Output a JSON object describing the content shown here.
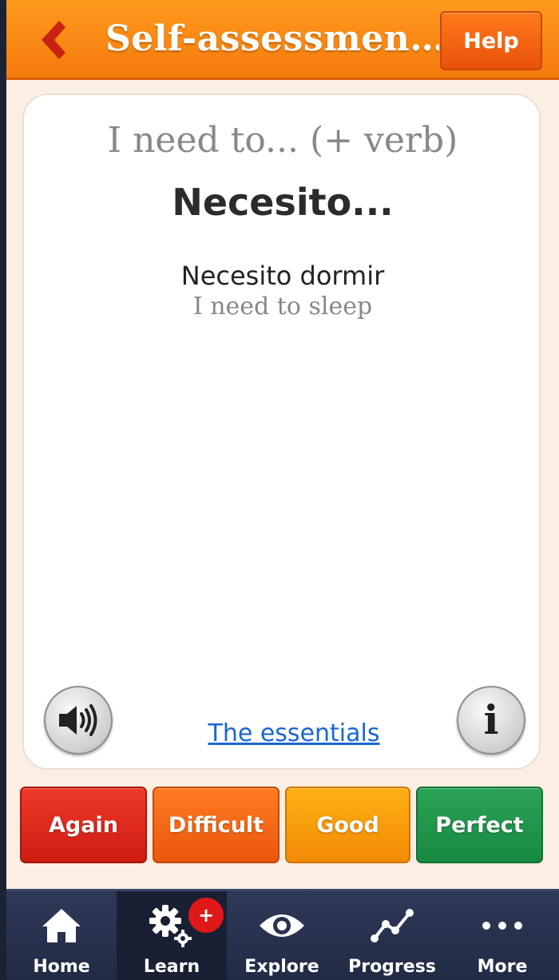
{
  "header": {
    "title": "Self-assessmen…",
    "help_label": "Help"
  },
  "card": {
    "prompt": "I need to... (+ verb)",
    "answer": "Necesito...",
    "example": "Necesito dormir",
    "example_translation": "I need to sleep",
    "link_label": "The essentials"
  },
  "grades": [
    {
      "label": "Again",
      "color": "#d9241a"
    },
    {
      "label": "Difficult",
      "color": "#f0600f"
    },
    {
      "label": "Good",
      "color": "#f79c0b"
    },
    {
      "label": "Perfect",
      "color": "#1f944b"
    }
  ],
  "nav": {
    "items": [
      {
        "label": "Home",
        "icon": "home-icon"
      },
      {
        "label": "Learn",
        "icon": "gears-icon",
        "badge": "+",
        "active": true
      },
      {
        "label": "Explore",
        "icon": "eye-icon"
      },
      {
        "label": "Progress",
        "icon": "progress-chart-icon"
      },
      {
        "label": "More",
        "icon": "more-dots-icon"
      }
    ]
  },
  "colors": {
    "header": "#f57a0c",
    "nav_bg": "#2a3350",
    "link": "#1a66d2"
  }
}
